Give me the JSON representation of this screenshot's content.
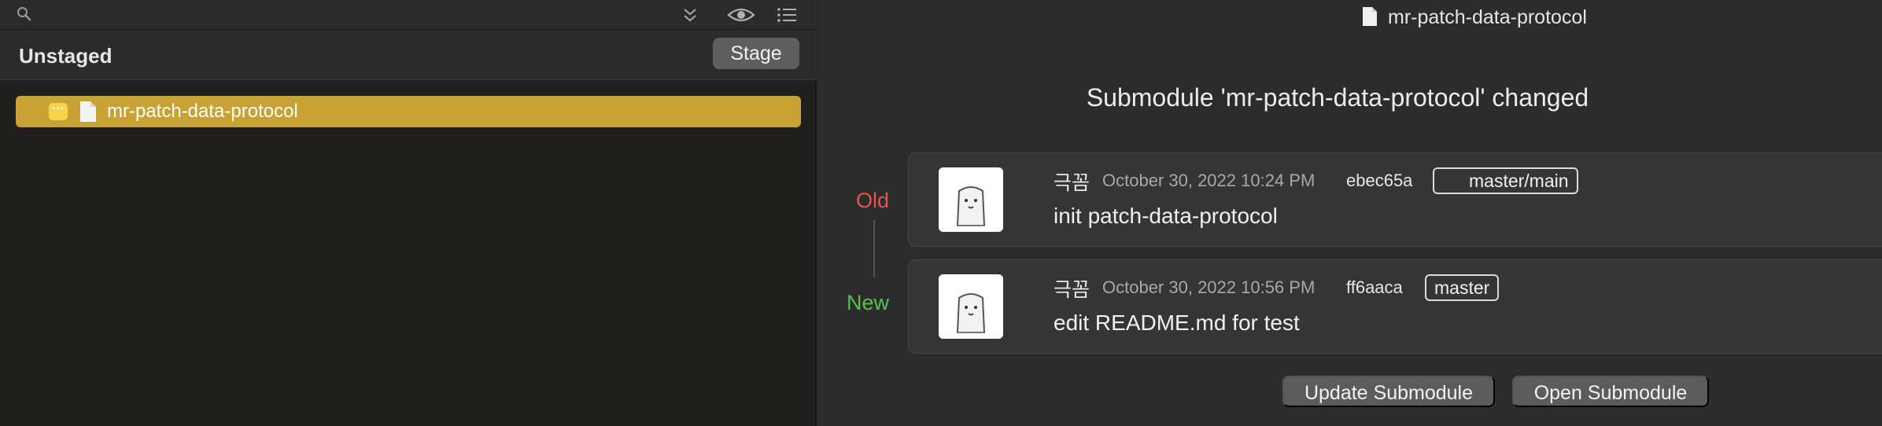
{
  "left_toolbar": {
    "icons": [
      "search-icon",
      "collapse-all-icon",
      "eye-icon",
      "list-icon"
    ]
  },
  "unstaged": {
    "title": "Unstaged",
    "stage_label": "Stage",
    "files": [
      {
        "status": "···",
        "name": "mr-patch-data-protocol"
      }
    ]
  },
  "window": {
    "title": "mr-patch-data-protocol"
  },
  "submodule": {
    "heading": "Submodule 'mr-patch-data-protocol' changed",
    "old_label": "Old",
    "new_label": "New",
    "old_commit": {
      "author": "극꼼",
      "date": "October 30, 2022 10:24 PM",
      "hash": "ebec65a",
      "branch": "master/main",
      "message": "init patch-data-protocol"
    },
    "new_commit": {
      "author": "극꼼",
      "date": "October 30, 2022 10:56 PM",
      "hash": "ff6aaca",
      "branch": "master",
      "message": "edit README.md for test"
    },
    "update_label": "Update Submodule",
    "open_label": "Open Submodule"
  },
  "colors": {
    "selection": "#c9a235",
    "old": "#e2574a",
    "new": "#55c152"
  }
}
